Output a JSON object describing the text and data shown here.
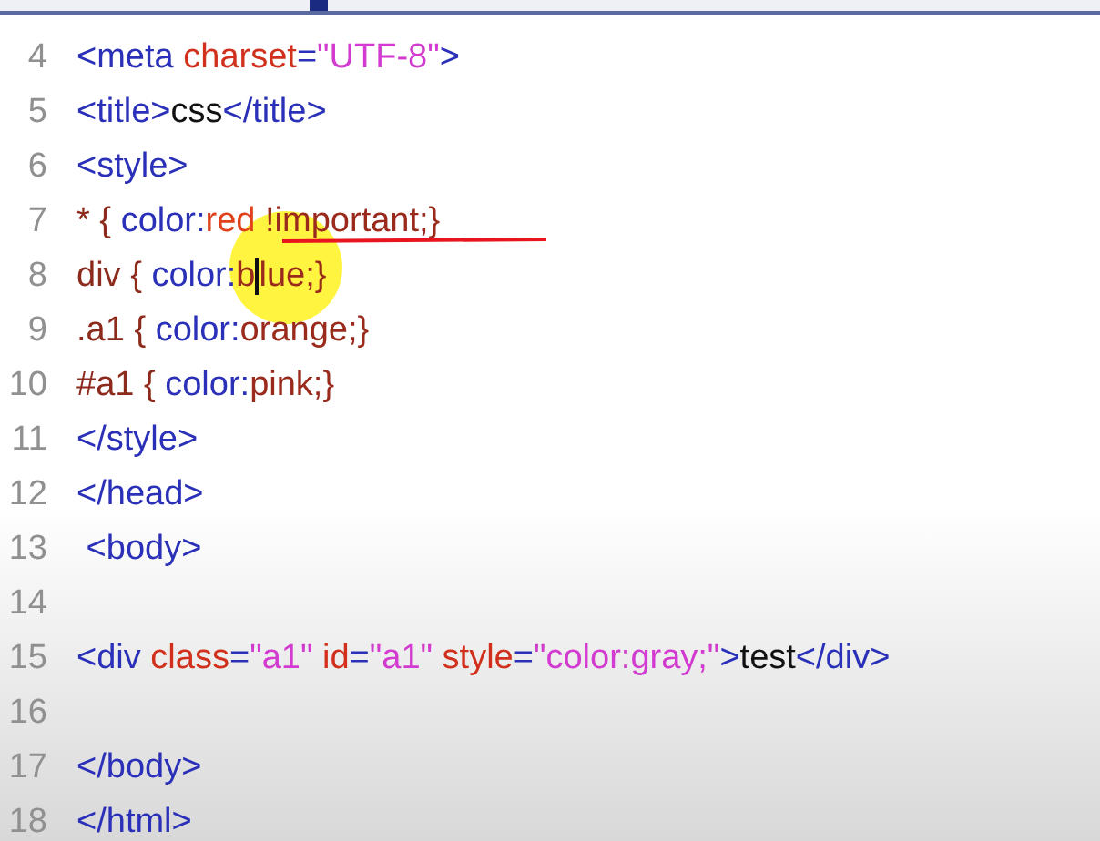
{
  "lines": [
    {
      "number": "4",
      "tokens": [
        {
          "kind": "tag",
          "text": "<meta "
        },
        {
          "kind": "attr",
          "text": "charset"
        },
        {
          "kind": "tag",
          "text": "="
        },
        {
          "kind": "string",
          "text": "\"UTF-8\""
        },
        {
          "kind": "tag",
          "text": ">"
        }
      ]
    },
    {
      "number": "5",
      "tokens": [
        {
          "kind": "tag",
          "text": "<title>"
        },
        {
          "kind": "text",
          "text": "css"
        },
        {
          "kind": "tag",
          "text": "</title>"
        }
      ]
    },
    {
      "number": "6",
      "tokens": [
        {
          "kind": "tag",
          "text": "<style>"
        }
      ]
    },
    {
      "number": "7",
      "tokens": [
        {
          "kind": "selector",
          "text": "* { "
        },
        {
          "kind": "property",
          "text": "color:"
        },
        {
          "kind": "highlight",
          "text": "red"
        },
        {
          "kind": "value",
          "text": " !important;}"
        }
      ]
    },
    {
      "number": "8",
      "tokens": [
        {
          "kind": "selector",
          "text": "div { "
        },
        {
          "kind": "property",
          "text": "color:"
        },
        {
          "kind": "value",
          "text": "b"
        },
        {
          "kind": "cursor"
        },
        {
          "kind": "value",
          "text": "lue;}"
        }
      ]
    },
    {
      "number": "9",
      "tokens": [
        {
          "kind": "selector",
          "text": ".a1 { "
        },
        {
          "kind": "property",
          "text": "color:"
        },
        {
          "kind": "value",
          "text": "orange;}"
        }
      ]
    },
    {
      "number": "10",
      "tokens": [
        {
          "kind": "selector",
          "text": "#a1 { "
        },
        {
          "kind": "property",
          "text": "color:"
        },
        {
          "kind": "value",
          "text": "pink;}"
        }
      ]
    },
    {
      "number": "11",
      "tokens": [
        {
          "kind": "tag",
          "text": "</style>"
        }
      ]
    },
    {
      "number": "12",
      "tokens": [
        {
          "kind": "tag",
          "text": "</head>"
        }
      ]
    },
    {
      "number": "13",
      "tokens": [
        {
          "kind": "tag",
          "text": " <body>"
        }
      ]
    },
    {
      "number": "14"
    },
    {
      "number": "15",
      "tokens": [
        {
          "kind": "tag",
          "text": "<div "
        },
        {
          "kind": "attr",
          "text": "class"
        },
        {
          "kind": "tag",
          "text": "="
        },
        {
          "kind": "string",
          "text": "\"a1\" "
        },
        {
          "kind": "attr",
          "text": "id"
        },
        {
          "kind": "tag",
          "text": "="
        },
        {
          "kind": "string",
          "text": "\"a1\" "
        },
        {
          "kind": "attr",
          "text": "style"
        },
        {
          "kind": "tag",
          "text": "="
        },
        {
          "kind": "string",
          "text": "\"color:gray;\""
        },
        {
          "kind": "tag",
          "text": ">"
        },
        {
          "kind": "text",
          "text": "test"
        },
        {
          "kind": "tag",
          "text": "</div>"
        }
      ]
    },
    {
      "number": "16"
    },
    {
      "number": "17",
      "tokens": [
        {
          "kind": "tag",
          "text": "</body>"
        }
      ]
    },
    {
      "number": "18",
      "tokens": [
        {
          "kind": "tag",
          "text": "</html>"
        }
      ]
    }
  ]
}
